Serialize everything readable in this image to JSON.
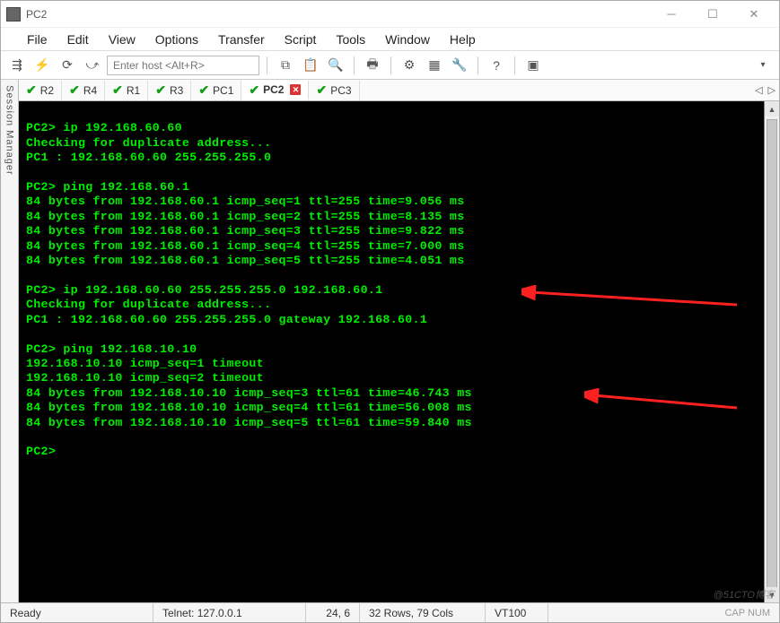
{
  "window": {
    "title": "PC2"
  },
  "menu": {
    "items": [
      "File",
      "Edit",
      "View",
      "Options",
      "Transfer",
      "Script",
      "Tools",
      "Window",
      "Help"
    ]
  },
  "toolbar": {
    "host_placeholder": "Enter host <Alt+R>"
  },
  "sessmgr": {
    "label": "Session Manager"
  },
  "tabs": {
    "items": [
      {
        "label": "R2",
        "active": false
      },
      {
        "label": "R4",
        "active": false
      },
      {
        "label": "R1",
        "active": false
      },
      {
        "label": "R3",
        "active": false
      },
      {
        "label": "PC1",
        "active": false
      },
      {
        "label": "PC2",
        "active": true
      },
      {
        "label": "PC3",
        "active": false
      }
    ]
  },
  "terminal": {
    "lines": [
      "",
      "PC2> ip 192.168.60.60",
      "Checking for duplicate address...",
      "PC1 : 192.168.60.60 255.255.255.0",
      "",
      "PC2> ping 192.168.60.1",
      "84 bytes from 192.168.60.1 icmp_seq=1 ttl=255 time=9.056 ms",
      "84 bytes from 192.168.60.1 icmp_seq=2 ttl=255 time=8.135 ms",
      "84 bytes from 192.168.60.1 icmp_seq=3 ttl=255 time=9.822 ms",
      "84 bytes from 192.168.60.1 icmp_seq=4 ttl=255 time=7.000 ms",
      "84 bytes from 192.168.60.1 icmp_seq=5 ttl=255 time=4.051 ms",
      "",
      "PC2> ip 192.168.60.60 255.255.255.0 192.168.60.1",
      "Checking for duplicate address...",
      "PC1 : 192.168.60.60 255.255.255.0 gateway 192.168.60.1",
      "",
      "PC2> ping 192.168.10.10",
      "192.168.10.10 icmp_seq=1 timeout",
      "192.168.10.10 icmp_seq=2 timeout",
      "84 bytes from 192.168.10.10 icmp_seq=3 ttl=61 time=46.743 ms",
      "84 bytes from 192.168.10.10 icmp_seq=4 ttl=61 time=56.008 ms",
      "84 bytes from 192.168.10.10 icmp_seq=5 ttl=61 time=59.840 ms",
      "",
      "PC2>"
    ]
  },
  "status": {
    "ready": "Ready",
    "conn": "Telnet: 127.0.0.1",
    "pos": "24,  6",
    "size": "32 Rows, 79 Cols",
    "emu": "VT100",
    "right": "CAP  NUM"
  },
  "watermark": "@51CTO博客"
}
